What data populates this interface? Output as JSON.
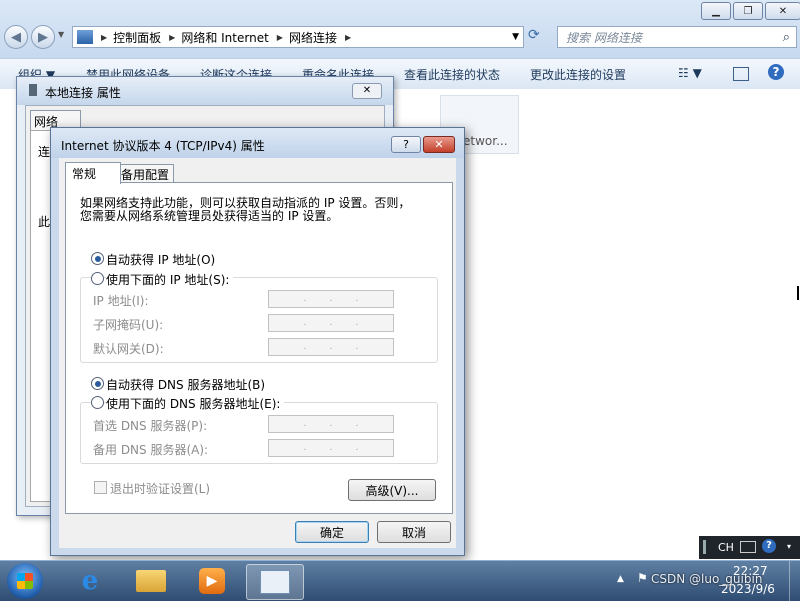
{
  "explorer": {
    "breadcrumb": [
      "控制面板",
      "网络和 Internet",
      "网络连接"
    ],
    "search_placeholder": "搜索 网络连接",
    "toolbar": [
      "组织 ▼",
      "禁用此网络设备",
      "诊断这个连接",
      "重命名此连接",
      "查看此连接的状态",
      "更改此连接的设置"
    ],
    "bg_item_text": "etwor..."
  },
  "dialog1": {
    "title": "本地连接 属性",
    "tab": "网络",
    "partial_label_1": "连",
    "partial_label_2": "此"
  },
  "dialog2": {
    "title": "Internet 协议版本 4 (TCP/IPv4) 属性",
    "tabs": [
      "常规",
      "备用配置"
    ],
    "intro": [
      "如果网络支持此功能，则可以获取自动指派的 IP 设置。否则，",
      "您需要从网络系统管理员处获得适当的 IP 设置。"
    ],
    "auto_ip": "自动获得 IP 地址(O)",
    "manual_ip": "使用下面的 IP 地址(S):",
    "ip_label": "IP 地址(I):",
    "mask_label": "子网掩码(U):",
    "gateway_label": "默认网关(D):",
    "auto_dns": "自动获得 DNS 服务器地址(B)",
    "manual_dns": "使用下面的 DNS 服务器地址(E):",
    "dns1_label": "首选 DNS 服务器(P):",
    "dns2_label": "备用 DNS 服务器(A):",
    "validate_label": "退出时验证设置(L)",
    "advanced_button": "高级(V)...",
    "ok_button": "确定",
    "cancel_button": "取消",
    "ip_dot": "."
  },
  "system": {
    "lang": "CH",
    "time": "22:27",
    "date": "2023/9/6",
    "watermark": "CSDN @luo_guibin"
  }
}
